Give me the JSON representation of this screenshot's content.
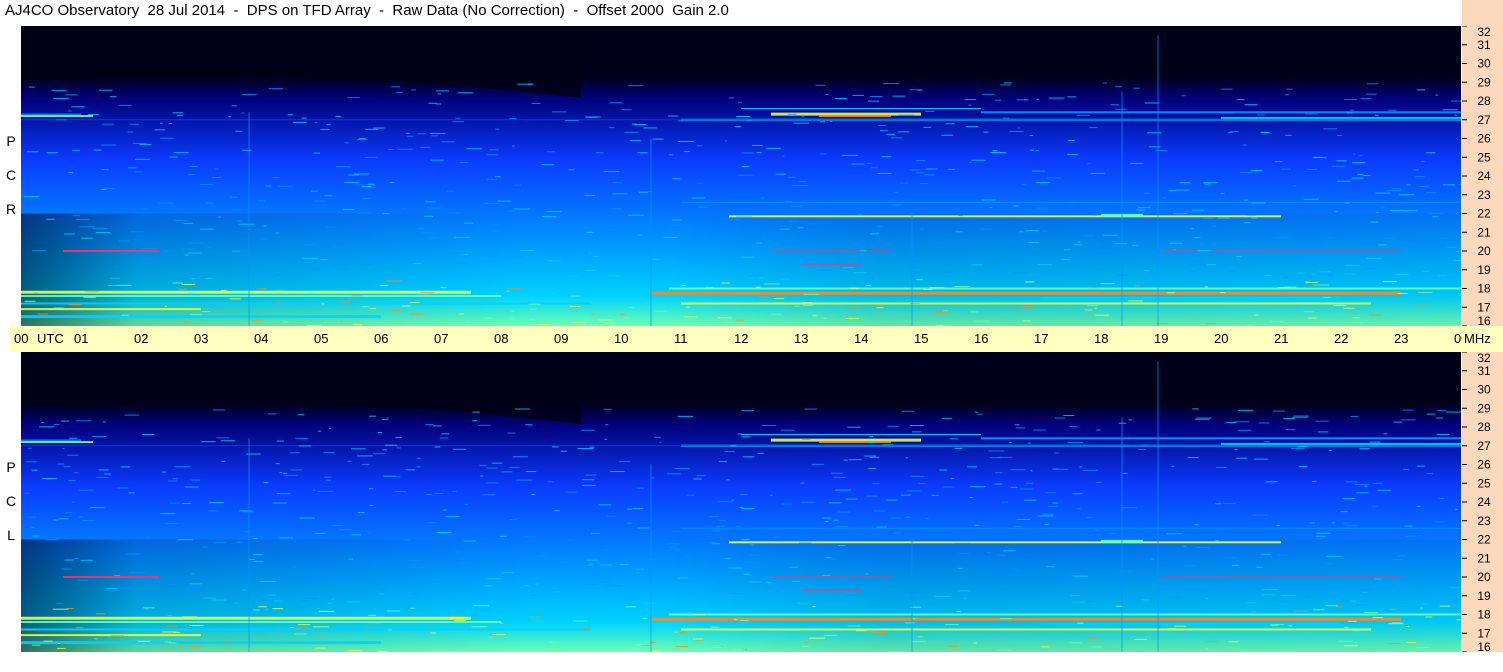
{
  "title": "AJ4CO Observatory  28 Jul 2014  -  DPS on TFD Array  -  Raw Data (No Correction)  -  Offset 2000  Gain 2.0",
  "panels": [
    {
      "id": "rcp",
      "label_letters": [
        "P",
        "C",
        "R"
      ]
    },
    {
      "id": "lcp",
      "label_letters": [
        "P",
        "C",
        "L"
      ]
    }
  ],
  "chart_data": {
    "type": "heatmap",
    "title": "AJ4CO Observatory  28 Jul 2014  -  DPS on TFD Array  -  Raw Data (No Correction)  -  Offset 2000  Gain 2.0",
    "x_axis": {
      "unit_label": "UTC",
      "ticks": [
        "00",
        "01",
        "02",
        "03",
        "04",
        "05",
        "06",
        "07",
        "08",
        "09",
        "10",
        "11",
        "12",
        "13",
        "14",
        "15",
        "16",
        "17",
        "18",
        "19",
        "20",
        "21",
        "22",
        "23",
        "00"
      ],
      "range_hours": [
        0,
        24
      ]
    },
    "y_axis": {
      "unit_label": "MHz",
      "ticks": [
        16,
        17,
        18,
        19,
        20,
        21,
        22,
        23,
        24,
        25,
        26,
        27,
        28,
        29,
        30,
        31,
        32
      ],
      "range_mhz": [
        16,
        32
      ]
    },
    "series": [
      {
        "name": "RCP"
      },
      {
        "name": "LCP"
      }
    ],
    "colormap": [
      "#000018",
      "#00007a",
      "#0a3cff",
      "#0096ff",
      "#00d2ff",
      "#6cffb0",
      "#e8ff40",
      "#ff8a20",
      "#ff3070"
    ]
  }
}
